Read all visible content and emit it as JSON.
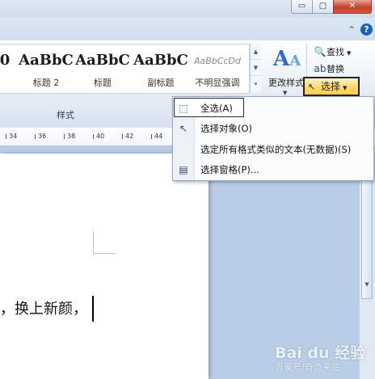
{
  "window": {
    "minimize_glyph": "▭",
    "maximize_glyph": "▢",
    "close_glyph": "✕"
  },
  "ribbon": {
    "help_glyph": "?",
    "collapse_glyph": "⌃",
    "styles_gallery": {
      "items": [
        {
          "sample": "0",
          "label": ""
        },
        {
          "sample": "AaBbC",
          "label": "标题 2"
        },
        {
          "sample": "AaBbC",
          "label": "标题"
        },
        {
          "sample": "AaBbC",
          "label": "副标题"
        },
        {
          "sample": "AaBbCcDd",
          "label": "不明显强调"
        }
      ],
      "group_label": "样式"
    },
    "change_styles": {
      "icon_text": "A",
      "label": "更改样式"
    },
    "editing": {
      "find_label": "查找",
      "replace_label": "替换",
      "select_label": "选择"
    }
  },
  "ruler": {
    "ticks": [
      "34",
      "36",
      "38",
      "40",
      "42",
      "44"
    ]
  },
  "document": {
    "text": "，换上新颜，"
  },
  "select_menu": {
    "items": [
      {
        "label": "全选(A)",
        "icon": "select-all-icon"
      },
      {
        "label": "选择对象(O)",
        "icon": "cursor-arrow-icon"
      },
      {
        "label": "选定所有格式类似的文本(无数据)(S)",
        "icon": "none"
      },
      {
        "label": "选择窗格(P)...",
        "icon": "selection-pane-icon"
      }
    ]
  },
  "watermark": {
    "logo": "Bai du 经验",
    "sub": "百家号/奇点来临"
  },
  "colors": {
    "highlight": "#ffd86b",
    "close_button": "#c4422c",
    "workspace": "#b9cde6"
  }
}
